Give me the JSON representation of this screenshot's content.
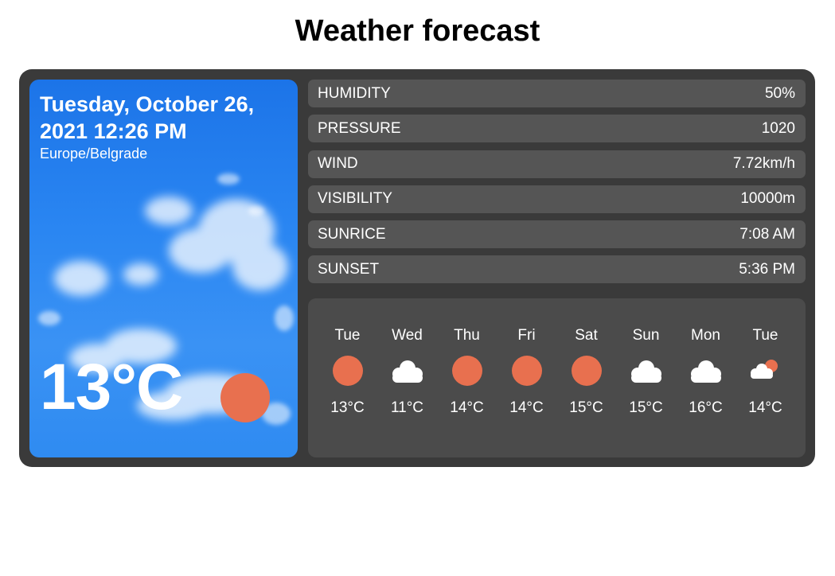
{
  "page": {
    "title": "Weather forecast"
  },
  "current": {
    "date": "Tuesday, October 26, 2021 12:26 PM",
    "timezone": "Europe/Belgrade",
    "temperature": "13°C",
    "icon": "sun-icon"
  },
  "stats": [
    {
      "label": "HUMIDITY",
      "value": "50%"
    },
    {
      "label": "PRESSURE",
      "value": "1020"
    },
    {
      "label": "WIND",
      "value": "7.72km/h"
    },
    {
      "label": "VISIBILITY",
      "value": "10000m"
    },
    {
      "label": "SUNRICE",
      "value": "7:08 AM"
    },
    {
      "label": "SUNSET",
      "value": "5:36 PM"
    }
  ],
  "forecast": [
    {
      "day": "Tue",
      "temp": "13°C",
      "icon": "sun-icon"
    },
    {
      "day": "Wed",
      "temp": "11°C",
      "icon": "cloud-icon"
    },
    {
      "day": "Thu",
      "temp": "14°C",
      "icon": "sun-icon"
    },
    {
      "day": "Fri",
      "temp": "14°C",
      "icon": "sun-icon"
    },
    {
      "day": "Sat",
      "temp": "15°C",
      "icon": "sun-icon"
    },
    {
      "day": "Sun",
      "temp": "15°C",
      "icon": "cloud-icon"
    },
    {
      "day": "Mon",
      "temp": "16°C",
      "icon": "cloud-icon"
    },
    {
      "day": "Tue",
      "temp": "14°C",
      "icon": "partly-cloudy-icon"
    }
  ],
  "colors": {
    "card_bg": "#3a3a3a",
    "stat_bg": "#555555",
    "forecast_bg": "#4b4b4b",
    "sun": "#e8704f",
    "cloud": "#ffffff"
  }
}
